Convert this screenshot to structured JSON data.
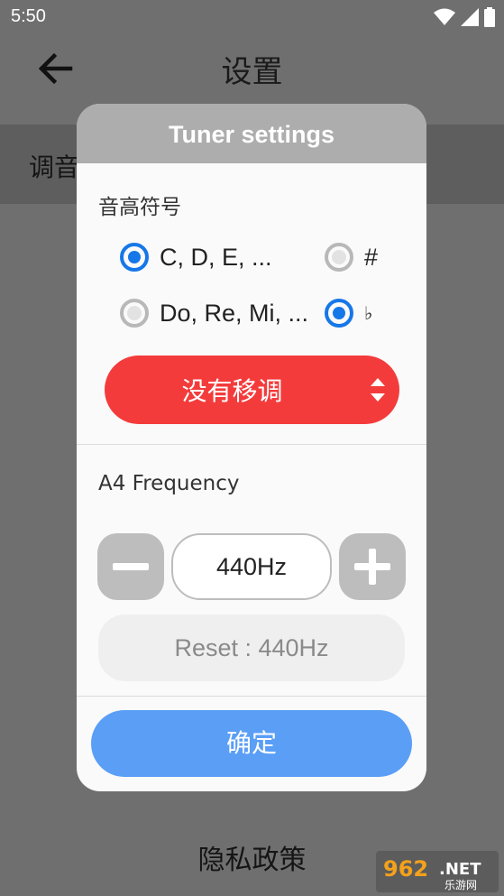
{
  "status_bar": {
    "time": "5:50"
  },
  "app_bar": {
    "title": "设置"
  },
  "background_rows": {
    "tuning_label": "调音",
    "privacy_label": "隐私政策"
  },
  "dialog": {
    "title": "Tuner settings",
    "note_names_section": "音高符号",
    "note_options": [
      {
        "label": "C, D, E, ...",
        "selected": true
      },
      {
        "label": "Do, Re, Mi, ...",
        "selected": false
      }
    ],
    "accidental_options": [
      {
        "label": "#",
        "selected": false
      },
      {
        "label": "♭",
        "selected": true
      }
    ],
    "transpose_value": "没有移调",
    "frequency_section": "A4 Frequency",
    "frequency_value": "440Hz",
    "reset_label": "Reset : 440Hz",
    "confirm_label": "确定"
  },
  "watermark": {
    "text": "962.NET",
    "subtext": "乐游网"
  },
  "colors": {
    "accent_blue": "#1677e8",
    "transpose_red": "#f43b3b",
    "confirm_blue": "#5a9ef6",
    "header_gray": "#adadad"
  }
}
